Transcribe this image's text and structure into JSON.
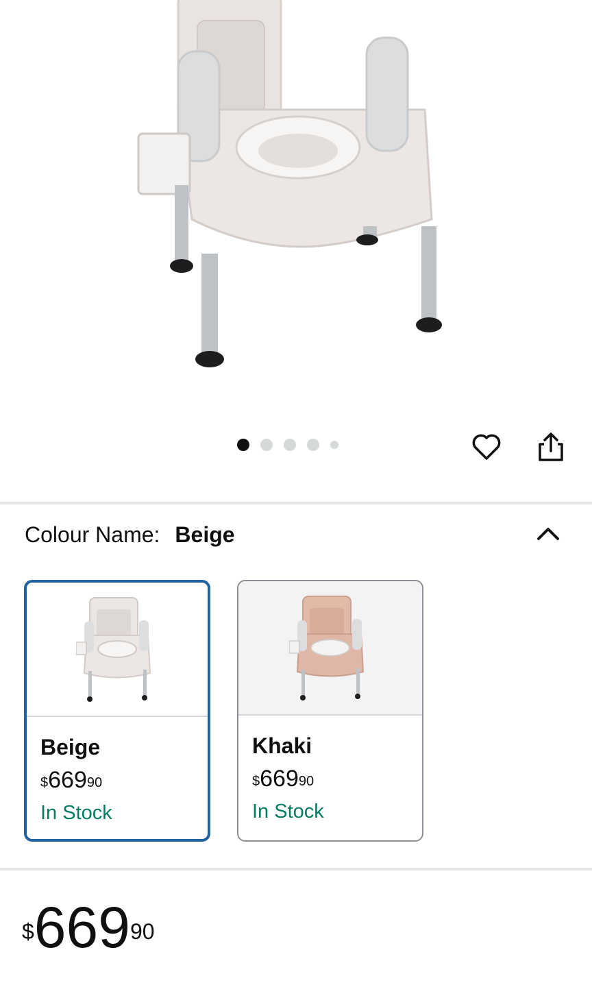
{
  "gallery": {
    "image_count": 5,
    "active_index": 0,
    "favorite_icon": "heart-outline-icon",
    "share_icon": "share-icon"
  },
  "colour": {
    "label": "Colour Name:",
    "selected": "Beige",
    "collapse_icon": "chevron-up-icon"
  },
  "variants": [
    {
      "name": "Beige",
      "currency": "$",
      "price_whole": "669",
      "price_fraction": "90",
      "stock": "In Stock",
      "selected": true
    },
    {
      "name": "Khaki",
      "currency": "$",
      "price_whole": "669",
      "price_fraction": "90",
      "stock": "In Stock",
      "selected": false
    }
  ],
  "price": {
    "currency": "$",
    "whole": "669",
    "fraction": "90"
  },
  "colors": {
    "stock_green": "#067d62",
    "selected_border": "#2162a1",
    "beige": "#e8e2df",
    "khaki": "#e0b7a6"
  }
}
